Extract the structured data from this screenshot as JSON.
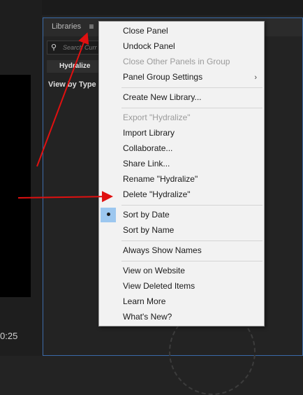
{
  "left": {
    "timecode": "0:25"
  },
  "libraries": {
    "title": "Libraries",
    "search_placeholder": "Search Curr",
    "library_name": "Hydralize",
    "view_by": "View by Type"
  },
  "menu": {
    "close_panel": "Close Panel",
    "undock_panel": "Undock Panel",
    "close_other_panels": "Close Other Panels in Group",
    "panel_group_settings": "Panel Group Settings",
    "create_new_library": "Create New Library...",
    "export": "Export \"Hydralize\"",
    "import_library": "Import Library",
    "collaborate": "Collaborate...",
    "share_link": "Share Link...",
    "rename": "Rename \"Hydralize\"",
    "delete": "Delete \"Hydralize\"",
    "sort_by_date": "Sort by Date",
    "sort_by_name": "Sort by Name",
    "always_show_names": "Always Show Names",
    "view_on_website": "View on Website",
    "view_deleted_items": "View Deleted Items",
    "learn_more": "Learn More",
    "whats_new": "What's New?"
  },
  "colors": {
    "arrow": "#e01010",
    "panel_border": "#3a6aa8",
    "menu_bg": "#f2f2f2",
    "checked_bg": "#9cc7ef"
  },
  "icons": {
    "panel_menu": "hamburger-icon",
    "search": "search-icon",
    "submenu": "chevron-right-icon",
    "selected": "bullet-icon"
  }
}
